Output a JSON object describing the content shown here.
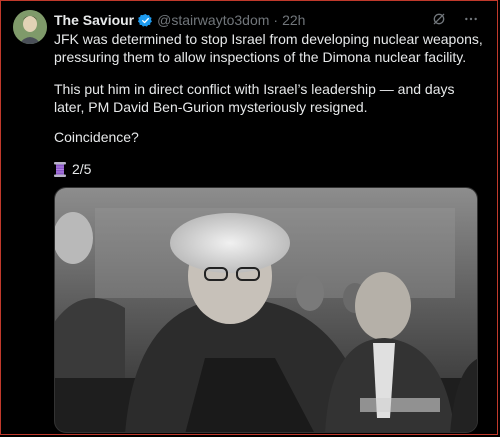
{
  "tweet": {
    "author_name": "The Saviour",
    "verified_icon": "verified-badge-icon",
    "handle": "@stairwayto3dom",
    "separator": "·",
    "time": "22h",
    "paragraph_1": "JFK was determined to stop Israel from developing nuclear weapons, pressuring them to allow inspections of the Dimona nuclear facility.",
    "paragraph_2": "This put him in direct conflict with Israel’s leadership — and days later, PM David Ben-Gurion mysteriously resigned.",
    "paragraph_3": "Coincidence?",
    "thread_icon": "thread-spool-icon",
    "thread_counter": "2/5"
  },
  "icons": {
    "grok": "grok-icon",
    "more": "more-options-icon"
  },
  "colors": {
    "background": "#000000",
    "text": "#e7e9ea",
    "muted": "#71767b",
    "verified": "#1d9bf0"
  }
}
